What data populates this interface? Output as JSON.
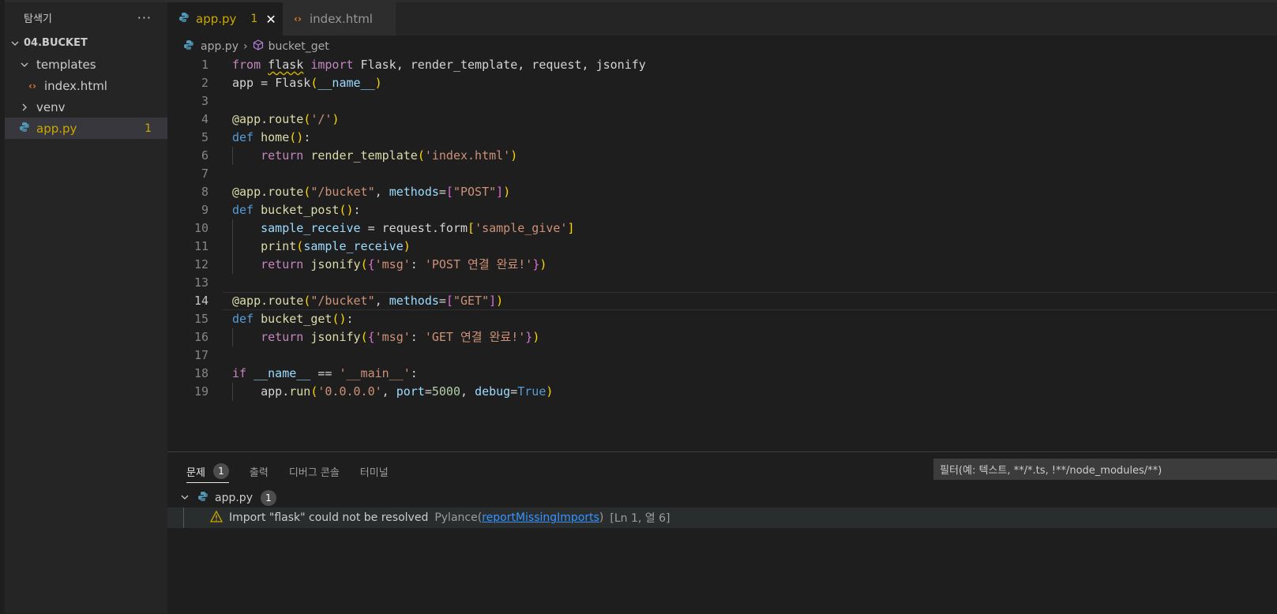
{
  "sidebar": {
    "title": "탐색기",
    "more": "···",
    "root_folder": "04.BUCKET",
    "items": [
      {
        "label": "templates"
      },
      {
        "label": "index.html"
      },
      {
        "label": "venv"
      },
      {
        "label": "app.py",
        "count": "1"
      }
    ]
  },
  "tabs": [
    {
      "label": "app.py",
      "count": "1",
      "close": "✕"
    },
    {
      "label": "index.html"
    }
  ],
  "breadcrumb": {
    "file": "app.py",
    "separator": "›",
    "symbol": "bucket_get"
  },
  "editor": {
    "current_line": 14,
    "line_numbers": [
      "1",
      "2",
      "3",
      "4",
      "5",
      "6",
      "7",
      "8",
      "9",
      "10",
      "11",
      "12",
      "13",
      "14",
      "15",
      "16",
      "17",
      "18",
      "19"
    ],
    "lines": [
      [
        [
          "kw",
          "from"
        ],
        [
          "t",
          " "
        ],
        [
          "squig",
          "flask"
        ],
        [
          "t",
          " "
        ],
        [
          "kw",
          "import"
        ],
        [
          "t",
          " Flask, render_template, request, jsonify"
        ]
      ],
      [
        [
          "t",
          "app = "
        ],
        [
          "t",
          "Flask"
        ],
        [
          "br1",
          "("
        ],
        [
          "var",
          "__name__"
        ],
        [
          "br1",
          ")"
        ]
      ],
      [],
      [
        [
          "fn",
          "@app.route"
        ],
        [
          "br1",
          "("
        ],
        [
          "str",
          "'/'"
        ],
        [
          "br1",
          ")"
        ]
      ],
      [
        [
          "kw2",
          "def"
        ],
        [
          "t",
          " "
        ],
        [
          "fn",
          "home"
        ],
        [
          "br1",
          "()"
        ],
        [
          "t",
          ":"
        ]
      ],
      [
        [
          "t",
          "    "
        ],
        [
          "kw",
          "return"
        ],
        [
          "t",
          " "
        ],
        [
          "fn",
          "render_template"
        ],
        [
          "br1",
          "("
        ],
        [
          "str",
          "'index.html'"
        ],
        [
          "br1",
          ")"
        ]
      ],
      [],
      [
        [
          "fn",
          "@app.route"
        ],
        [
          "br1",
          "("
        ],
        [
          "str",
          "\"/bucket\""
        ],
        [
          "t",
          ", "
        ],
        [
          "var",
          "methods"
        ],
        [
          "t",
          "="
        ],
        [
          "br2",
          "["
        ],
        [
          "str",
          "\"POST\""
        ],
        [
          "br2",
          "]"
        ],
        [
          "br1",
          ")"
        ]
      ],
      [
        [
          "kw2",
          "def"
        ],
        [
          "t",
          " "
        ],
        [
          "fn",
          "bucket_post"
        ],
        [
          "br1",
          "()"
        ],
        [
          "t",
          ":"
        ]
      ],
      [
        [
          "t",
          "    "
        ],
        [
          "var",
          "sample_receive"
        ],
        [
          "t",
          " = request.form"
        ],
        [
          "br1",
          "["
        ],
        [
          "str",
          "'sample_give'"
        ],
        [
          "br1",
          "]"
        ]
      ],
      [
        [
          "t",
          "    "
        ],
        [
          "fn",
          "print"
        ],
        [
          "br1",
          "("
        ],
        [
          "var",
          "sample_receive"
        ],
        [
          "br1",
          ")"
        ]
      ],
      [
        [
          "t",
          "    "
        ],
        [
          "kw",
          "return"
        ],
        [
          "t",
          " "
        ],
        [
          "fn",
          "jsonify"
        ],
        [
          "br1",
          "("
        ],
        [
          "br2",
          "{"
        ],
        [
          "str",
          "'msg'"
        ],
        [
          "t",
          ": "
        ],
        [
          "str",
          "'POST 연결 완료!'"
        ],
        [
          "br2",
          "}"
        ],
        [
          "br1",
          ")"
        ]
      ],
      [],
      [
        [
          "fn",
          "@app.route"
        ],
        [
          "br1",
          "("
        ],
        [
          "str",
          "\"/bucket\""
        ],
        [
          "t",
          ", "
        ],
        [
          "var",
          "methods"
        ],
        [
          "t",
          "="
        ],
        [
          "br2",
          "["
        ],
        [
          "str",
          "\"GET\""
        ],
        [
          "br2",
          "]"
        ],
        [
          "br1",
          ")"
        ]
      ],
      [
        [
          "kw2",
          "def"
        ],
        [
          "t",
          " "
        ],
        [
          "fn",
          "bucket_get"
        ],
        [
          "br1",
          "()"
        ],
        [
          "t",
          ":"
        ]
      ],
      [
        [
          "t",
          "    "
        ],
        [
          "kw",
          "return"
        ],
        [
          "t",
          " "
        ],
        [
          "fn",
          "jsonify"
        ],
        [
          "br1",
          "("
        ],
        [
          "br2",
          "{"
        ],
        [
          "str",
          "'msg'"
        ],
        [
          "t",
          ": "
        ],
        [
          "str",
          "'GET 연결 완료!'"
        ],
        [
          "br2",
          "}"
        ],
        [
          "br1",
          ")"
        ]
      ],
      [],
      [
        [
          "kw",
          "if"
        ],
        [
          "t",
          " "
        ],
        [
          "var",
          "__name__"
        ],
        [
          "t",
          " == "
        ],
        [
          "str",
          "'__main__'"
        ],
        [
          "t",
          ":"
        ]
      ],
      [
        [
          "t",
          "    app."
        ],
        [
          "fn",
          "run"
        ],
        [
          "br1",
          "("
        ],
        [
          "str",
          "'0.0.0.0'"
        ],
        [
          "t",
          ", "
        ],
        [
          "var",
          "port"
        ],
        [
          "t",
          "="
        ],
        [
          "num",
          "5000"
        ],
        [
          "t",
          ", "
        ],
        [
          "var",
          "debug"
        ],
        [
          "t",
          "="
        ],
        [
          "kw2",
          "True"
        ],
        [
          "br1",
          ")"
        ]
      ]
    ]
  },
  "panel": {
    "tabs": [
      {
        "label": "문제",
        "badge": "1"
      },
      {
        "label": "출력"
      },
      {
        "label": "디버그 콘솔"
      },
      {
        "label": "터미널"
      }
    ],
    "filter_placeholder": "필터(예: 텍스트, **/*.ts, !**/node_modules/**)",
    "file": {
      "name": "app.py",
      "count": "1"
    },
    "problem": {
      "message": "Import \"flask\" could not be resolved",
      "source": "Pylance",
      "code_open": "(",
      "code": "reportMissingImports",
      "code_close": ")",
      "position": "[Ln 1, 열 6]"
    }
  },
  "colors": {
    "background": "#1e1e1e",
    "sidebar": "#252526",
    "warning": "#cca700",
    "link": "#3794ff"
  },
  "icons": [
    "python-file-icon",
    "html-file-icon",
    "chevron-down-icon",
    "chevron-right-icon",
    "symbol-method-icon",
    "warning-icon"
  ]
}
